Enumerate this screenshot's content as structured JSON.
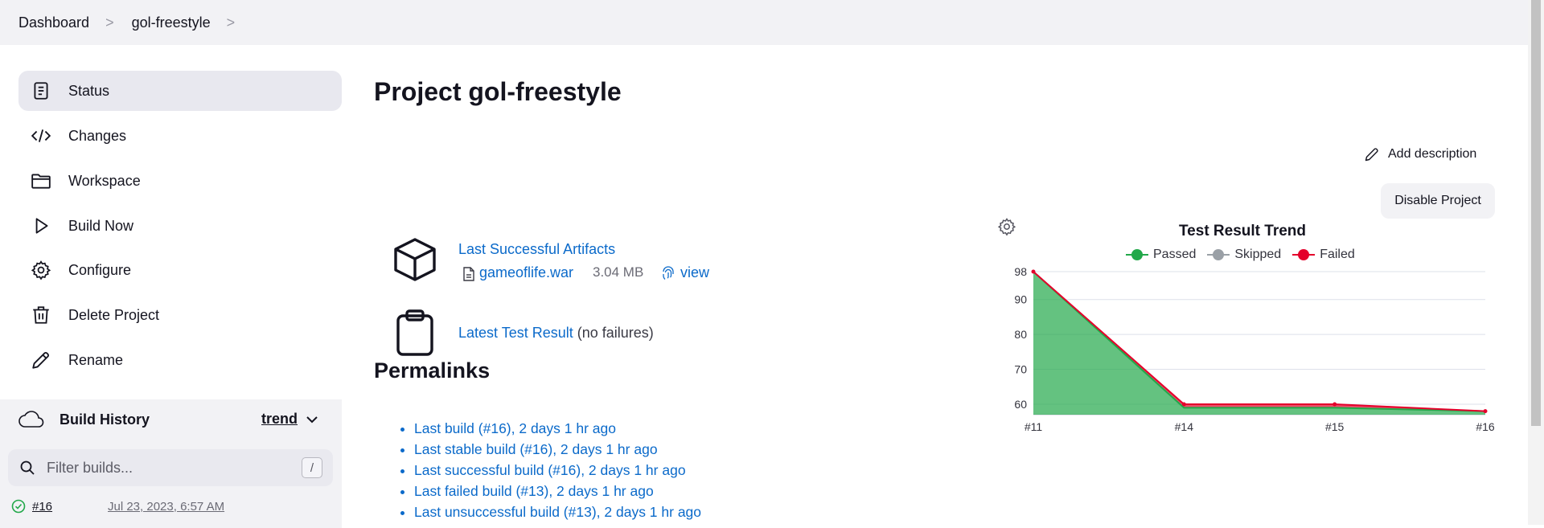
{
  "breadcrumb": {
    "items": [
      "Dashboard",
      "gol-freestyle"
    ],
    "separator": ">"
  },
  "sidebar": {
    "items": [
      {
        "label": "Status",
        "icon": "document-icon",
        "active": true
      },
      {
        "label": "Changes",
        "icon": "code-icon"
      },
      {
        "label": "Workspace",
        "icon": "folder-icon"
      },
      {
        "label": "Build Now",
        "icon": "play-icon"
      },
      {
        "label": "Configure",
        "icon": "gear-icon"
      },
      {
        "label": "Delete Project",
        "icon": "trash-icon"
      },
      {
        "label": "Rename",
        "icon": "pencil-icon"
      }
    ]
  },
  "build_history": {
    "title": "Build History",
    "trend_label": "trend",
    "filter_placeholder": "Filter builds...",
    "shortcut_key": "/",
    "builds": [
      {
        "number": "#16",
        "date": "Jul 23, 2023, 6:57 AM",
        "status": "success"
      }
    ]
  },
  "main": {
    "title": "Project gol-freestyle",
    "add_description": "Add description",
    "disable_button": "Disable Project",
    "artifacts": {
      "label": "Last Successful Artifacts",
      "file_name": "gameoflife.war",
      "file_size": "3.04 MB",
      "view_label": "view"
    },
    "test_result": {
      "link": "Latest Test Result",
      "note": "(no failures)"
    },
    "permalinks": {
      "title": "Permalinks",
      "items": [
        "Last build (#16), 2 days 1 hr ago",
        "Last stable build (#16), 2 days 1 hr ago",
        "Last successful build (#16), 2 days 1 hr ago",
        "Last failed build (#13), 2 days 1 hr ago",
        "Last unsuccessful build (#13), 2 days 1 hr ago"
      ]
    }
  },
  "colors": {
    "passed": "#22a84a",
    "skipped": "#9aa0a6",
    "failed": "#e4002b",
    "link": "#0b6aca"
  },
  "chart_data": {
    "type": "area",
    "title": "Test Result Trend",
    "categories": [
      "#11",
      "#14",
      "#15",
      "#16"
    ],
    "y_ticks": [
      60,
      70,
      80,
      90,
      98
    ],
    "ylim": [
      57,
      98
    ],
    "series": [
      {
        "name": "Passed",
        "values": [
          98,
          59,
          59,
          58
        ]
      },
      {
        "name": "Skipped",
        "values": [
          0,
          0,
          0,
          0
        ]
      },
      {
        "name": "Failed",
        "values": [
          0,
          1,
          1,
          0
        ]
      }
    ],
    "legend_position": "top",
    "grid": true
  }
}
